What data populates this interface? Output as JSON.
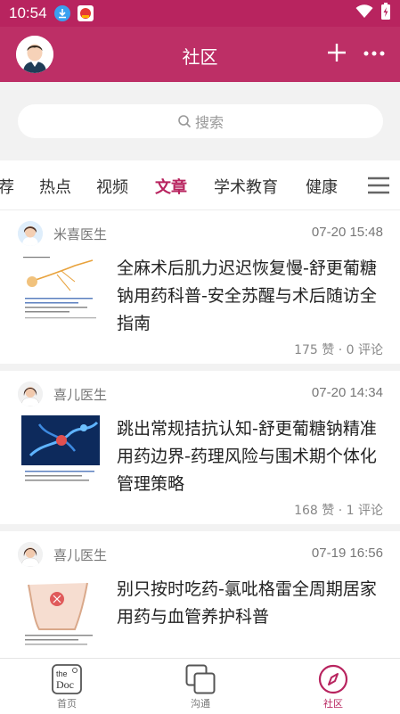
{
  "status_bar": {
    "time": "10:54"
  },
  "header": {
    "title": "社区"
  },
  "search": {
    "placeholder": "搜索"
  },
  "tabs": [
    {
      "label": "荐"
    },
    {
      "label": "热点"
    },
    {
      "label": "视频"
    },
    {
      "label": "文章",
      "active": true
    },
    {
      "label": "学术教育"
    },
    {
      "label": "健康"
    }
  ],
  "posts": [
    {
      "author": "米喜医生",
      "date": "07-20 15:48",
      "title": "全麻术后肌力迟迟恢复慢-舒更葡糖钠用药科普-安全苏醒与术后随访全指南",
      "stats": "175 赞 · 0 评论"
    },
    {
      "author": "喜儿医生",
      "date": "07-20 14:34",
      "title": "跳出常规拮抗认知-舒更葡糖钠精准用药边界-药理风险与围术期个体化管理策略",
      "stats": "168 赞 · 1 评论"
    },
    {
      "author": "喜儿医生",
      "date": "07-19 16:56",
      "title": "别只按时吃药-氯吡格雷全周期居家用药与血管养护科普",
      "stats": ""
    }
  ],
  "bottom_nav": [
    {
      "label": "首页",
      "icon_text_top": "the",
      "icon_text_bottom": "Doc"
    },
    {
      "label": "沟通"
    },
    {
      "label": "社区",
      "active": true
    }
  ],
  "colors": {
    "brand": "#bd2f66",
    "status_bar": "#b8245f",
    "active": "#b8245f"
  }
}
